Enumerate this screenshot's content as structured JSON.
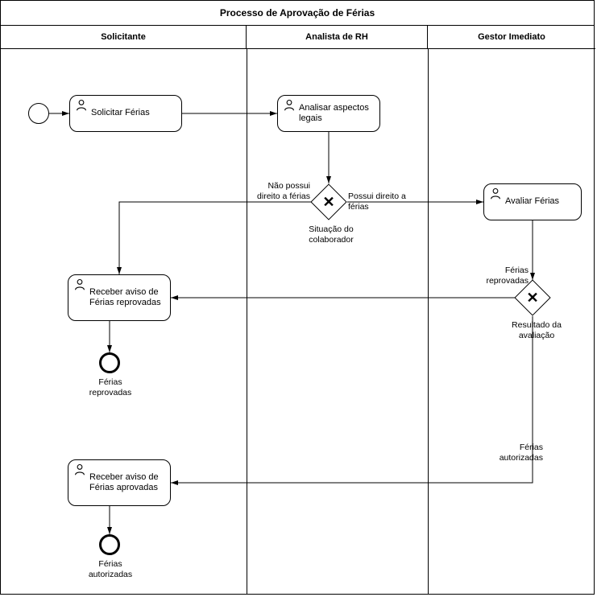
{
  "pool": {
    "title": "Processo de Aprovação de Férias",
    "lanes": {
      "l1": "Solicitante",
      "l2": "Analista de RH",
      "l3": "Gestor Imediato"
    }
  },
  "tasks": {
    "solicitar": "Solicitar Férias",
    "analisar": "Analisar aspectos legais",
    "avaliar": "Avaliar Férias",
    "receberReprovadas": "Receber aviso de Férias reprovadas",
    "receberAprovadas": "Receber aviso de Férias aprovadas"
  },
  "gateways": {
    "situacao": "Situação do colaborador",
    "resultado": "Resultado da avaliação"
  },
  "edges": {
    "naoPossui": "Não possui direito a férias",
    "possui": "Possui direito a férias",
    "reprovadas": "Férias reprovadas",
    "autorizadasEdge": "Férias autorizadas"
  },
  "ends": {
    "reprovadas": "Férias reprovadas",
    "autorizadas": "Férias autorizadas"
  }
}
